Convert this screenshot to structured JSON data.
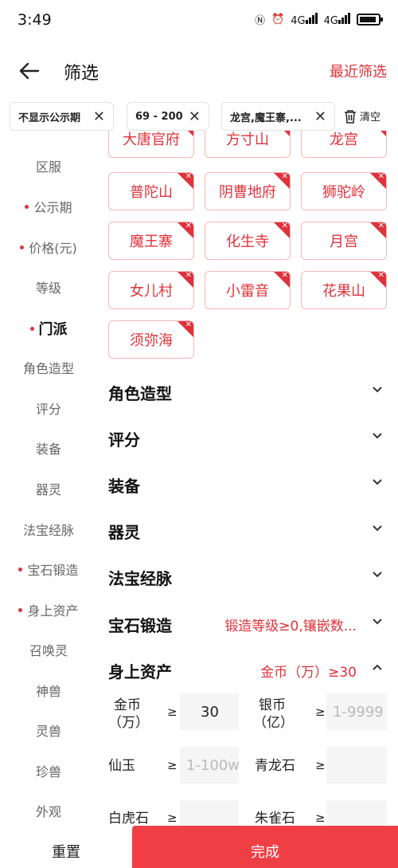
{
  "status": {
    "time": "3:49",
    "net1": "4G",
    "net2": "4G"
  },
  "header": {
    "title": "筛选",
    "recent": "最近筛选"
  },
  "chips": [
    {
      "label": "不显示公示期"
    },
    {
      "label": "69 - 200"
    },
    {
      "label": "龙宫,魔王寨,..."
    }
  ],
  "clear_label": "清空",
  "sidebar": [
    {
      "label": "区服",
      "dot": false,
      "active": false
    },
    {
      "label": "公示期",
      "dot": true,
      "active": false
    },
    {
      "label": "价格(元)",
      "dot": true,
      "active": false
    },
    {
      "label": "等级",
      "dot": false,
      "active": false
    },
    {
      "label": "门派",
      "dot": true,
      "active": true
    },
    {
      "label": "角色造型",
      "dot": false,
      "active": false
    },
    {
      "label": "评分",
      "dot": false,
      "active": false
    },
    {
      "label": "装备",
      "dot": false,
      "active": false
    },
    {
      "label": "器灵",
      "dot": false,
      "active": false
    },
    {
      "label": "法宝经脉",
      "dot": false,
      "active": false
    },
    {
      "label": "宝石锻造",
      "dot": true,
      "active": false
    },
    {
      "label": "身上资产",
      "dot": true,
      "active": false
    },
    {
      "label": "召唤灵",
      "dot": false,
      "active": false
    },
    {
      "label": "神兽",
      "dot": false,
      "active": false
    },
    {
      "label": "灵兽",
      "dot": false,
      "active": false
    },
    {
      "label": "珍兽",
      "dot": false,
      "active": false
    },
    {
      "label": "外观",
      "dot": false,
      "active": false
    }
  ],
  "schools": [
    "大唐官府",
    "方寸山",
    "龙宫",
    "普陀山",
    "阴曹地府",
    "狮驼岭",
    "魔王寨",
    "化生寺",
    "月宫",
    "女儿村",
    "小雷音",
    "花果山",
    "须弥海"
  ],
  "sections": [
    {
      "label": "角色造型",
      "sub": ""
    },
    {
      "label": "评分",
      "sub": ""
    },
    {
      "label": "装备",
      "sub": ""
    },
    {
      "label": "器灵",
      "sub": ""
    },
    {
      "label": "法宝经脉",
      "sub": ""
    },
    {
      "label": "宝石锻造",
      "sub": "锻造等级≥0,镶嵌数..."
    },
    {
      "label": "身上资产",
      "sub": "金币（万）≥30"
    }
  ],
  "assets": {
    "gold_label_1": "金币",
    "gold_label_2": "（万）",
    "gold_value": "30",
    "ge": "≥",
    "silver_label_1": "银币",
    "silver_label_2": "（亿）",
    "silver_placeholder": "1-9999",
    "jade_label": "仙玉",
    "jade_placeholder": "1-100w",
    "qinglong_label": "青龙石",
    "baihu_label": "白虎石",
    "zhuque_label": "朱雀石"
  },
  "bottom": {
    "reset": "重置",
    "done": "完成"
  },
  "colors": {
    "accent": "#e0323b"
  }
}
